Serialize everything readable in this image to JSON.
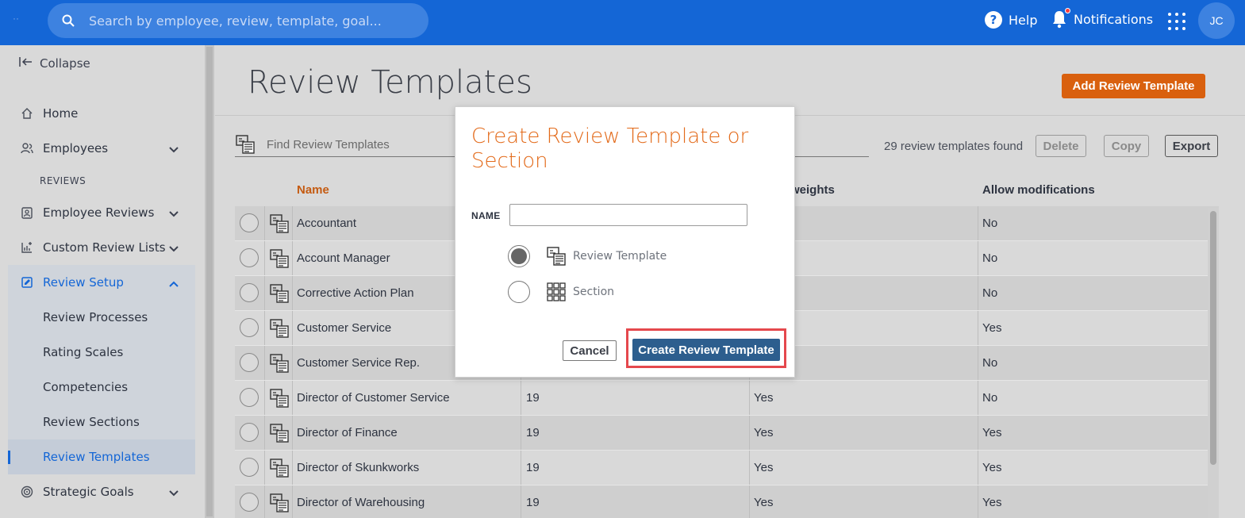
{
  "topbar": {
    "search_placeholder": "Search by employee, review, template, goal...",
    "help_label": "Help",
    "notifications_label": "Notifications",
    "avatar_initials": "JC",
    "brand_color": "#1466d6"
  },
  "sidebar": {
    "collapse_label": "Collapse",
    "home": "Home",
    "employees": "Employees",
    "section_reviews": "REVIEWS",
    "employee_reviews": "Employee Reviews",
    "custom_review_lists": "Custom Review Lists",
    "review_setup": "Review Setup",
    "sub_items": [
      "Review Processes",
      "Rating Scales",
      "Competencies",
      "Review Sections",
      "Review Templates"
    ],
    "strategic_goals": "Strategic Goals"
  },
  "main": {
    "page_title": "Review Templates",
    "add_button": "Add Review Template",
    "find_placeholder": "Find Review Templates",
    "count_text": "29 review templates found",
    "delete_label": "Delete",
    "copy_label": "Copy",
    "export_label": "Export",
    "columns": [
      "Name",
      "",
      "weights",
      "Allow modifications"
    ],
    "rows": [
      {
        "name": "Accountant",
        "col2": "",
        "col3": "",
        "allow": "No"
      },
      {
        "name": "Account Manager",
        "col2": "",
        "col3": "",
        "allow": "No"
      },
      {
        "name": "Corrective Action Plan",
        "col2": "",
        "col3": "",
        "allow": "No"
      },
      {
        "name": "Customer Service",
        "col2": "",
        "col3": "",
        "allow": "Yes"
      },
      {
        "name": "Customer Service Rep.",
        "col2": "",
        "col3": "",
        "allow": "No"
      },
      {
        "name": "Director of Customer Service",
        "col2": "19",
        "col3": "Yes",
        "allow": "No"
      },
      {
        "name": "Director of Finance",
        "col2": "19",
        "col3": "Yes",
        "allow": "Yes"
      },
      {
        "name": "Director of Skunkworks",
        "col2": "19",
        "col3": "Yes",
        "allow": "Yes"
      },
      {
        "name": "Director of Warehousing",
        "col2": "19",
        "col3": "Yes",
        "allow": "Yes"
      }
    ]
  },
  "modal": {
    "title": "Create Review Template or Section",
    "name_label": "NAME",
    "name_value": "",
    "option_template": "Review Template",
    "option_section": "Section",
    "selected_option": "Review Template",
    "cancel_label": "Cancel",
    "create_label": "Create Review Template",
    "accent_color": "#e36a1a"
  }
}
